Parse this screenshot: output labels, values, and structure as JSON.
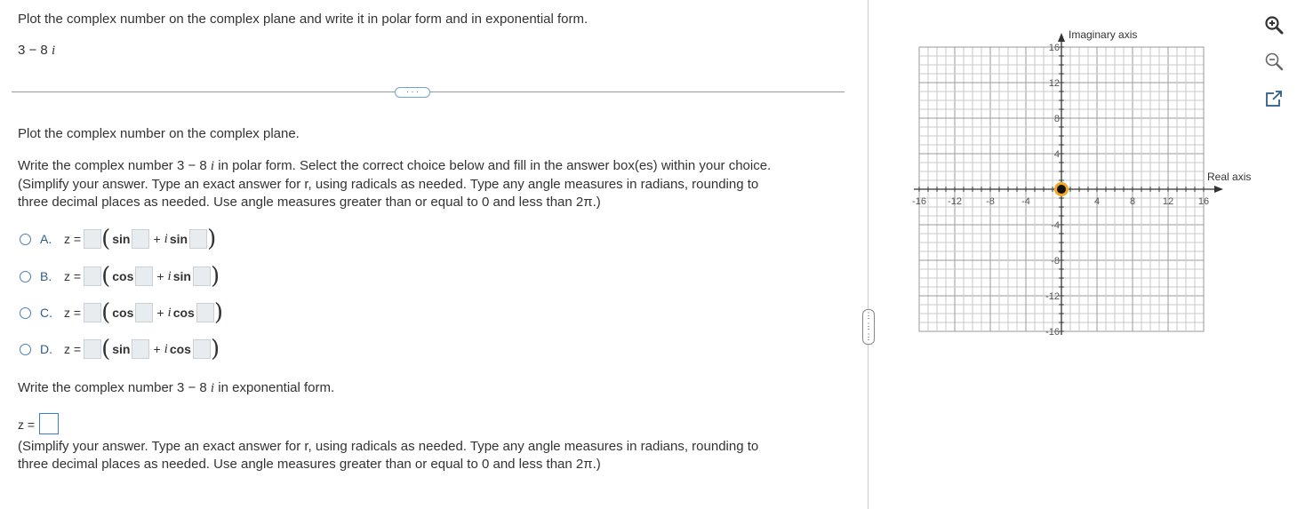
{
  "question": {
    "prompt": "Plot the complex number on the complex plane and write it in polar form and in exponential form.",
    "number": "3 − 8",
    "i": "i"
  },
  "part1": {
    "plot_instruction": "Plot the complex number on the complex plane.",
    "polar_instruction_a": "Write the complex number 3 − 8",
    "polar_instruction_b": " in polar form. Select the correct choice below and fill in the answer box(es) within your choice.",
    "hint_line1": "(Simplify your answer. Type an exact answer for r, using radicals as needed. Type any angle measures in radians, rounding to",
    "hint_line2": "three decimal places as needed. Use angle measures greater than or equal to 0 and less than 2π.)"
  },
  "choices": [
    {
      "letter": "A.",
      "fn1": "sin",
      "fn2": "sin"
    },
    {
      "letter": "B.",
      "fn1": "cos",
      "fn2": "sin"
    },
    {
      "letter": "C.",
      "fn1": "cos",
      "fn2": "cos"
    },
    {
      "letter": "D.",
      "fn1": "sin",
      "fn2": "cos"
    }
  ],
  "choice_labels": {
    "z": "z =",
    "plus": "+",
    "i": "i"
  },
  "part2": {
    "exp_instruction_a": "Write the complex number 3 − 8",
    "exp_instruction_b": " in exponential form.",
    "z": "z =",
    "hint_line1": "(Simplify your answer. Type an exact answer for r, using radicals as needed. Type any angle measures in radians, rounding to",
    "hint_line2": "three decimal places as needed. Use angle measures greater than or equal to 0 and less than 2π.)"
  },
  "more_button": "· · ·",
  "splitter_handle": "⋮",
  "graph": {
    "imag_axis_label": "Imaginary axis",
    "real_axis_label": "Real axis",
    "x_ticks": [
      "-16",
      "-12",
      "-8",
      "-4",
      "4",
      "8",
      "12",
      "16"
    ],
    "y_ticks": [
      "16",
      "12",
      "8",
      "4",
      "-4",
      "-8",
      "-12",
      "-16"
    ],
    "range": [
      -16,
      16
    ],
    "grid_step": 1,
    "point": {
      "x": 0,
      "y": 0
    },
    "point_color": "#f5a623"
  },
  "tools": [
    "zoom-in-icon",
    "zoom-out-icon",
    "external-link-icon"
  ]
}
